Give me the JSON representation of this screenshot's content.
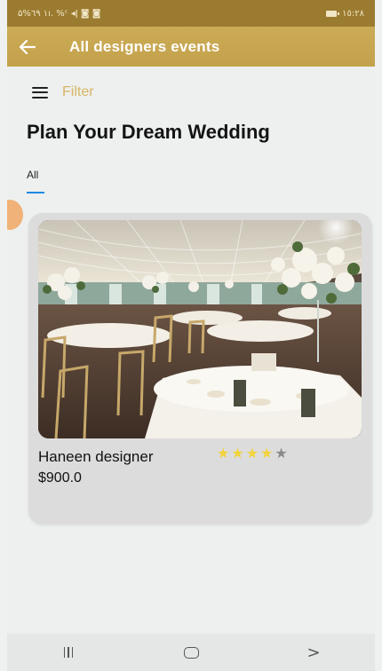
{
  "status_bar": {
    "left_text": "۵%٦٩ ۱ı. %ᶜ ◂ǀ ◙ ◙",
    "right_text": "١٥:٢٨"
  },
  "app_bar": {
    "title": "All designers events",
    "back_icon": "arrow-left-icon",
    "background": "#c9a752"
  },
  "filter": {
    "label": "Filter",
    "icon": "menu-icon",
    "label_color": "#d9b566"
  },
  "page": {
    "title": "Plan Your Dream Wedding"
  },
  "tabs": [
    {
      "label": "All",
      "selected": true
    }
  ],
  "events": [
    {
      "designer_name": "Haneen designer",
      "price": "$900.0",
      "rating": 4,
      "rating_max": 5,
      "image": "wedding-reception-hall-photo"
    }
  ],
  "colors": {
    "accent_gold": "#c9a752",
    "star_filled": "#f2d33a",
    "star_empty": "#8a8a8a",
    "tab_indicator": "#1e88e5"
  },
  "nav_bar": {
    "recent_icon": "recent-apps-icon",
    "home_icon": "home-icon",
    "back_icon": "chevron-right-icon"
  }
}
